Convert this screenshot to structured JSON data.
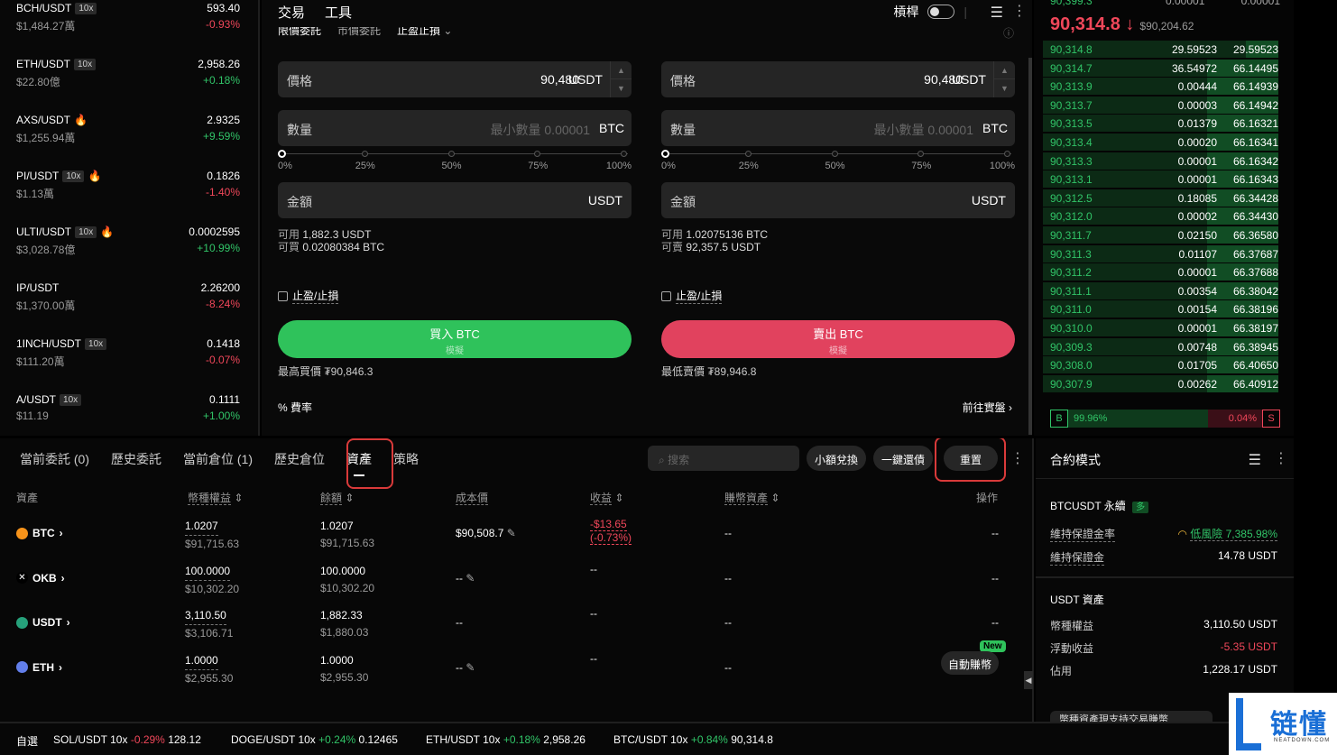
{
  "markets": [
    {
      "symbol": "BCH/USDT",
      "leverage": "10x",
      "hot": false,
      "volume": "$1,484.27萬",
      "price": "593.40",
      "change": "-0.93%",
      "dir": "down"
    },
    {
      "symbol": "ETH/USDT",
      "leverage": "10x",
      "hot": false,
      "volume": "$22.80億",
      "price": "2,958.26",
      "change": "+0.18%",
      "dir": "up"
    },
    {
      "symbol": "AXS/USDT",
      "leverage": "",
      "hot": true,
      "volume": "$1,255.94萬",
      "price": "2.9325",
      "change": "+9.59%",
      "dir": "up"
    },
    {
      "symbol": "PI/USDT",
      "leverage": "10x",
      "hot": true,
      "volume": "$1.13萬",
      "price": "0.1826",
      "change": "-1.40%",
      "dir": "down"
    },
    {
      "symbol": "ULTI/USDT",
      "leverage": "10x",
      "hot": true,
      "volume": "$3,028.78億",
      "price": "0.0002595",
      "change": "+10.99%",
      "dir": "up"
    },
    {
      "symbol": "IP/USDT",
      "leverage": "",
      "hot": false,
      "volume": "$1,370.00萬",
      "price": "2.26200",
      "change": "-8.24%",
      "dir": "down"
    },
    {
      "symbol": "1INCH/USDT",
      "leverage": "10x",
      "hot": false,
      "volume": "$111.20萬",
      "price": "0.1418",
      "change": "-0.07%",
      "dir": "down"
    },
    {
      "symbol": "A/USDT",
      "leverage": "10x",
      "hot": false,
      "volume": "$11.19",
      "price": "0.1111",
      "change": "+1.00%",
      "dir": "up"
    }
  ],
  "trade": {
    "tabs": [
      "交易",
      "工具"
    ],
    "leverage_label": "槓桿",
    "subtabs": [
      "限價委託",
      "市價委託",
      "止盈止損"
    ],
    "buy": {
      "price_label": "價格",
      "price": "90,480",
      "price_unit": "USDT",
      "qty_label": "數量",
      "qty_placeholder": "最小數量 0.00001",
      "qty_unit": "BTC",
      "pcts": [
        "0%",
        "25%",
        "50%",
        "75%",
        "100%"
      ],
      "amount_label": "金額",
      "amount_unit": "USDT",
      "avail_label": "可用",
      "avail": "1,882.3 USDT",
      "can_label": "可買",
      "can": "0.02080384 BTC",
      "tpsl": "止盈/止損",
      "button": "買入 BTC",
      "button_sub": "模擬",
      "note": "最高買價 ₮90,846.3"
    },
    "sell": {
      "price_label": "價格",
      "price": "90,480",
      "price_unit": "USDT",
      "qty_label": "數量",
      "qty_placeholder": "最小數量 0.00001",
      "qty_unit": "BTC",
      "pcts": [
        "0%",
        "25%",
        "50%",
        "75%",
        "100%"
      ],
      "amount_label": "金額",
      "amount_unit": "USDT",
      "avail_label": "可用",
      "avail": "1.02075136 BTC",
      "can_label": "可賣",
      "can": "92,357.5 USDT",
      "tpsl": "止盈/止損",
      "button": "賣出 BTC",
      "button_sub": "模擬",
      "note": "最低賣價 ₮89,946.8"
    },
    "rate_label": "費率",
    "go_real": "前往實盤"
  },
  "book": {
    "top_price": "90,399.3",
    "top_qty": "0.00001",
    "top_total": "0.00001",
    "last_price": "90,314.8",
    "last_arrow": "↓",
    "last_usd": "$90,204.62",
    "rows": [
      {
        "p": "90,314.8",
        "q": "29.59523",
        "t": "29.59523",
        "depth": 0.45
      },
      {
        "p": "90,314.7",
        "q": "36.54972",
        "t": "66.14495",
        "depth": 1.0
      },
      {
        "p": "90,313.9",
        "q": "0.00444",
        "t": "66.14939",
        "depth": 1.0
      },
      {
        "p": "90,313.7",
        "q": "0.00003",
        "t": "66.14942",
        "depth": 1.0
      },
      {
        "p": "90,313.5",
        "q": "0.01379",
        "t": "66.16321",
        "depth": 1.0
      },
      {
        "p": "90,313.4",
        "q": "0.00020",
        "t": "66.16341",
        "depth": 1.0
      },
      {
        "p": "90,313.3",
        "q": "0.00001",
        "t": "66.16342",
        "depth": 1.0
      },
      {
        "p": "90,313.1",
        "q": "0.00001",
        "t": "66.16343",
        "depth": 1.0
      },
      {
        "p": "90,312.5",
        "q": "0.18085",
        "t": "66.34428",
        "depth": 1.0
      },
      {
        "p": "90,312.0",
        "q": "0.00002",
        "t": "66.34430",
        "depth": 1.0
      },
      {
        "p": "90,311.7",
        "q": "0.02150",
        "t": "66.36580",
        "depth": 1.0
      },
      {
        "p": "90,311.3",
        "q": "0.01107",
        "t": "66.37687",
        "depth": 1.0
      },
      {
        "p": "90,311.2",
        "q": "0.00001",
        "t": "66.37688",
        "depth": 1.0
      },
      {
        "p": "90,311.1",
        "q": "0.00354",
        "t": "66.38042",
        "depth": 1.0
      },
      {
        "p": "90,311.0",
        "q": "0.00154",
        "t": "66.38196",
        "depth": 1.0
      },
      {
        "p": "90,310.0",
        "q": "0.00001",
        "t": "66.38197",
        "depth": 1.0
      },
      {
        "p": "90,309.3",
        "q": "0.00748",
        "t": "66.38945",
        "depth": 1.0
      },
      {
        "p": "90,308.0",
        "q": "0.01705",
        "t": "66.40650",
        "depth": 1.0
      },
      {
        "p": "90,307.9",
        "q": "0.00262",
        "t": "66.40912",
        "depth": 1.0
      }
    ],
    "buy_label": "B",
    "buy_pct": "99.96%",
    "sell_pct": "0.04%",
    "sell_label": "S"
  },
  "bottom": {
    "tabs": [
      "當前委託 (0)",
      "歷史委託",
      "當前倉位 (1)",
      "歷史倉位",
      "資產",
      "策略"
    ],
    "search_placeholder": "搜索",
    "btn_small": "小額兌換",
    "btn_repay": "一鍵還債",
    "btn_reset": "重置",
    "headers": [
      "資產",
      "幣種權益",
      "餘額",
      "成本價",
      "收益",
      "賺幣資產",
      "操作"
    ],
    "assets": [
      {
        "name": "BTC",
        "eq": "1.0207",
        "eq_usd": "$91,715.63",
        "bal": "1.0207",
        "bal_usd": "$91,715.63",
        "cost": "$90,508.7",
        "pnl": "-$13.65",
        "pnl_pct": "(-0.73%)",
        "earn": "--",
        "op": "--"
      },
      {
        "name": "OKB",
        "eq": "100.0000",
        "eq_usd": "$10,302.20",
        "bal": "100.0000",
        "bal_usd": "$10,302.20",
        "cost": "--",
        "pnl": "--",
        "pnl_pct": "",
        "earn": "--",
        "op": "--"
      },
      {
        "name": "USDT",
        "eq": "3,110.50",
        "eq_usd": "$3,106.71",
        "bal": "1,882.33",
        "bal_usd": "$1,880.03",
        "cost": "--",
        "pnl": "--",
        "pnl_pct": "",
        "earn": "--",
        "op": "--"
      },
      {
        "name": "ETH",
        "eq": "1.0000",
        "eq_usd": "$2,955.30",
        "bal": "1.0000",
        "bal_usd": "$2,955.30",
        "cost": "--",
        "pnl": "--",
        "pnl_pct": "",
        "earn": "--",
        "op": ""
      }
    ],
    "auto_earn": "自動賺幣",
    "new_badge": "New"
  },
  "contract": {
    "title": "合約模式",
    "instrument": "BTCUSDT 永續",
    "side_badge": "多",
    "margin_ratio_label": "維持保證金率",
    "margin_ratio": "低風險 7,385.98%",
    "margin_label": "維持保證金",
    "margin": "14.78 USDT",
    "usdt_title": "USDT 資產",
    "equity_label": "幣種權益",
    "equity": "3,110.50 USDT",
    "float_label": "浮動收益",
    "float": "-5.35 USDT",
    "used_label": "佔用",
    "used": "1,228.17 USDT",
    "cut_text": "幣種資產現支持交易賺幣"
  },
  "ticker": {
    "label": "自選",
    "items": [
      {
        "sym": "SOL/USDT 10x",
        "chg": "-0.29%",
        "price": "128.12",
        "dir": "down"
      },
      {
        "sym": "DOGE/USDT 10x",
        "chg": "+0.24%",
        "price": "0.12465",
        "dir": "up"
      },
      {
        "sym": "ETH/USDT 10x",
        "chg": "+0.18%",
        "price": "2,958.26",
        "dir": "up"
      },
      {
        "sym": "BTC/USDT 10x",
        "chg": "+0.84%",
        "price": "90,314.8",
        "dir": "up"
      }
    ]
  },
  "logo": {
    "text": "链懂",
    "sub": "NEATDOWN.COM"
  },
  "colors": {
    "green": "#31c468",
    "red": "#f0475a",
    "highlight": "#d93a3a"
  }
}
